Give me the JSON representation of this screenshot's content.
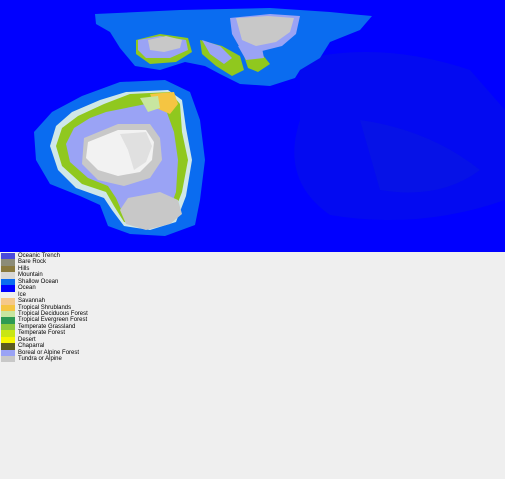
{
  "map": {
    "colors": {
      "deep_ocean": "#0000ff",
      "ocean": "#0020f0",
      "shallow_ocean": "#0a6cf0",
      "ice": "#cfe7e8",
      "grassland": "#90c81e",
      "boreal": "#9aa3f5",
      "tundra": "#c8c8c8",
      "mountain": "#f2f2f2",
      "savannah": "#f5c542"
    }
  },
  "legend": {
    "items": [
      {
        "label": "Oceanic Trench",
        "color": "#4a4adc"
      },
      {
        "label": "Bare Rock",
        "color": "#8c8c78"
      },
      {
        "label": "Hills",
        "color": "#8a7a3e"
      },
      {
        "label": "Mountain",
        "color": "#d8d8d8"
      },
      {
        "label": "Shallow Ocean",
        "color": "#0a6cf0"
      },
      {
        "label": "Ocean",
        "color": "#0000ff"
      },
      {
        "label": "Ice",
        "color": "#f0f0f0"
      },
      {
        "label": "Savannah",
        "color": "#f5c88a"
      },
      {
        "label": "Tropical Shrublands",
        "color": "#f5c542"
      },
      {
        "label": "Tropical Deciduous Forest",
        "color": "#c8e6a0"
      },
      {
        "label": "Tropical Evergreen Forest",
        "color": "#2e9a52"
      },
      {
        "label": "Temperate Grassland",
        "color": "#8cc83c"
      },
      {
        "label": "Temperate Forest",
        "color": "#c8e614"
      },
      {
        "label": "Desert",
        "color": "#f5f500"
      },
      {
        "label": "Chaparral",
        "color": "#5a5a1e"
      },
      {
        "label": "Boreal or Alpine Forest",
        "color": "#9aa3f5"
      },
      {
        "label": "Tundra or Alpine",
        "color": "#c8c8c8"
      }
    ]
  }
}
